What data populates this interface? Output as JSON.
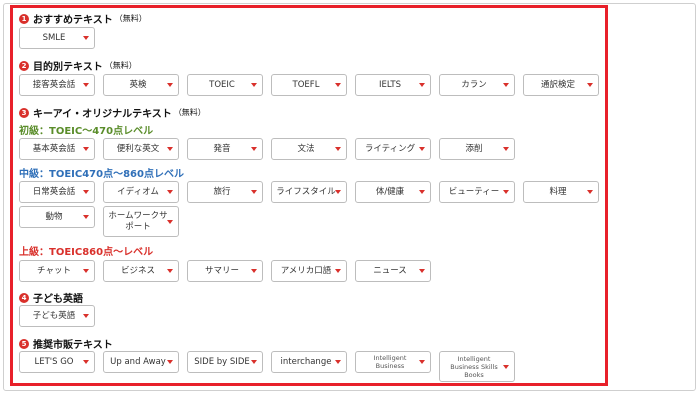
{
  "sections": {
    "s1": {
      "num": "1",
      "title": "おすすめテキスト",
      "note": "（無料）"
    },
    "s2": {
      "num": "2",
      "title": "目的別テキスト",
      "note": "（無料）"
    },
    "s3": {
      "num": "3",
      "title": "キーアイ・オリジナルテキスト",
      "note": "（無料）"
    },
    "s4": {
      "num": "4",
      "title": "子ども英語",
      "note": ""
    },
    "s5": {
      "num": "5",
      "title": "推奨市販テキスト",
      "note": ""
    }
  },
  "levels": {
    "beginner": "初級：TOEIC～470点レベル",
    "intermediate": "中級：TOEIC470点～860点レベル",
    "advanced": "上級：TOEIC860点～レベル"
  },
  "recommended": [
    "SMLE"
  ],
  "purpose": [
    "接客英会話",
    "英検",
    "TOEIC",
    "TOEFL",
    "IELTS",
    "カラン",
    "通訳検定"
  ],
  "beginner": [
    "基本英会話",
    "便利な英文",
    "発音",
    "文法",
    "ライティング",
    "添削"
  ],
  "intermediate_row1": [
    "日常英会話",
    "イディオム",
    "旅行",
    "ライフスタイル",
    "体/健康",
    "ビューティー",
    "料理"
  ],
  "intermediate_row2": [
    "動物",
    "ホームワークサポート"
  ],
  "advanced": [
    "チャット",
    "ビジネス",
    "サマリー",
    "アメリカ口語",
    "ニュース"
  ],
  "kids": [
    "子ども英語"
  ],
  "commercial": [
    "LET'S GO",
    "Up and Away",
    "SIDE by SIDE",
    "interchange",
    "Intelligent Business",
    "Intelligent Business Skills Books"
  ],
  "colors": {
    "accent": "#e8202a",
    "caret": "#d9302b",
    "beginner": "#5a8d2a",
    "intermediate": "#2f6fb8",
    "advanced": "#d9302b"
  },
  "icons": {
    "dropdown": "caret-down-icon",
    "number": "number-badge-icon"
  }
}
